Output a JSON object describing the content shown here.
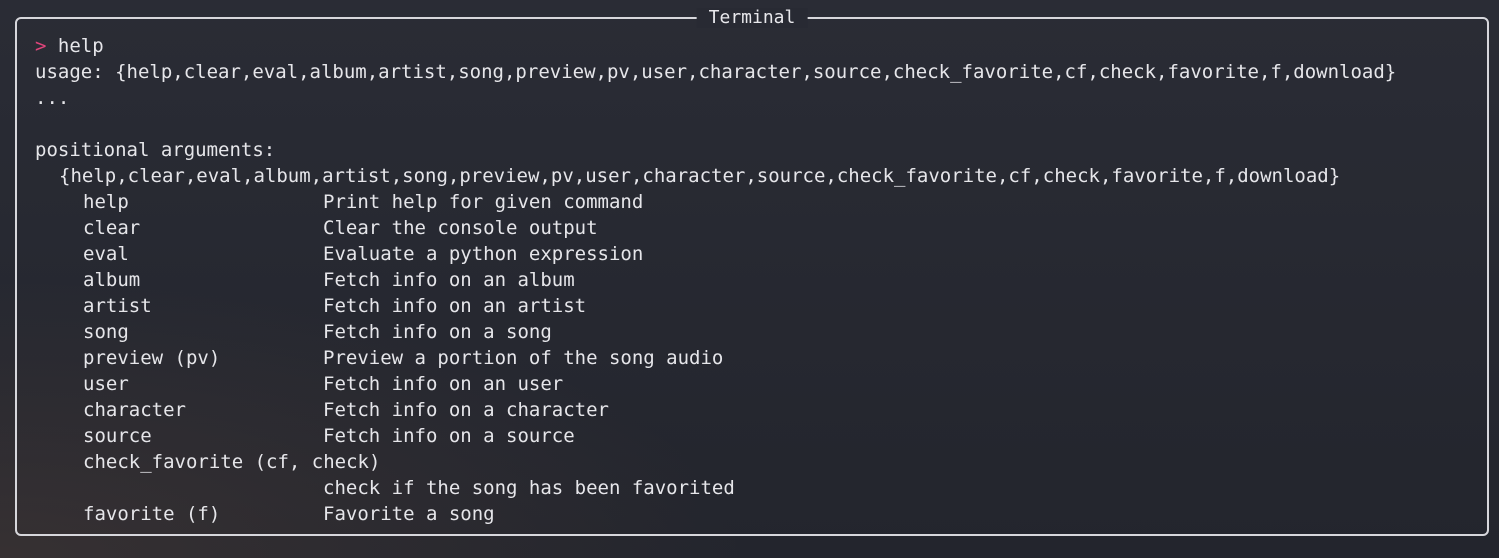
{
  "window": {
    "title": "Terminal"
  },
  "prompt": {
    "symbol": ">",
    "command": " help"
  },
  "output": {
    "usage": "usage: {help,clear,eval,album,artist,song,preview,pv,user,character,source,check_favorite,cf,check,favorite,f,download}",
    "ellipsis": "...",
    "blank": "",
    "positional_header": "positional arguments:",
    "choices": "{help,clear,eval,album,artist,song,preview,pv,user,character,source,check_favorite,cf,check,favorite,f,download}",
    "commands": [
      {
        "name": "help",
        "desc": "Print help for given command"
      },
      {
        "name": "clear",
        "desc": "Clear the console output"
      },
      {
        "name": "eval",
        "desc": "Evaluate a python expression"
      },
      {
        "name": "album",
        "desc": "Fetch info on an album"
      },
      {
        "name": "artist",
        "desc": "Fetch info on an artist"
      },
      {
        "name": "song",
        "desc": "Fetch info on a song"
      },
      {
        "name": "preview (pv)",
        "desc": "Preview a portion of the song audio"
      },
      {
        "name": "user",
        "desc": "Fetch info on an user"
      },
      {
        "name": "character",
        "desc": "Fetch info on a character"
      },
      {
        "name": "source",
        "desc": "Fetch info on a source"
      }
    ],
    "check_favorite": {
      "name": "check_favorite (cf, check)",
      "desc": "check if the song has been favorited"
    },
    "favorite": {
      "name": "favorite (f)",
      "desc": "Favorite a song"
    }
  },
  "colors": {
    "prompt_symbol": "#e0457b",
    "text": "#e6e6ea",
    "border": "#d7d7dc",
    "background": "#25272f"
  }
}
